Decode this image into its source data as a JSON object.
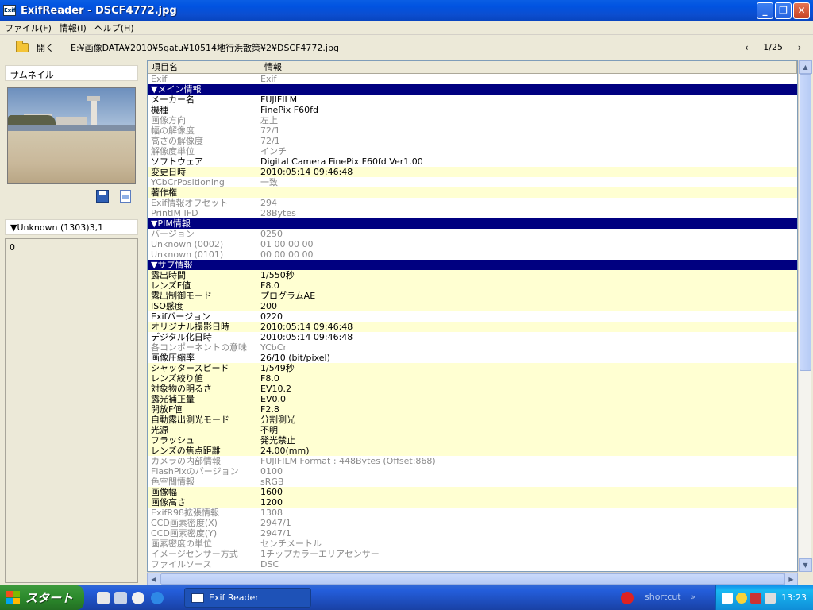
{
  "window": {
    "title": "ExifReader - DSCF4772.jpg",
    "icon_text": "Exif"
  },
  "menu": [
    "ファイル(F)",
    "情報(I)",
    "ヘルプ(H)"
  ],
  "toolbar": {
    "open_label": "開く",
    "path": "E:¥画像DATA¥2010¥5gatu¥10514地行浜散策¥2¥DSCF4772.jpg",
    "prev": "‹",
    "next": "›",
    "page": "1/25"
  },
  "sidebar": {
    "thumb_label": "サムネイル",
    "detail_header": "▼Unknown (1303)3,1",
    "detail_value": "0"
  },
  "table": {
    "col_key": "項目名",
    "col_val": "情報"
  },
  "rows": [
    {
      "t": "dim",
      "k": "Exif",
      "v": "Exif"
    },
    {
      "t": "sec",
      "k": "▼メイン情報",
      "v": ""
    },
    {
      "t": "norm",
      "k": "メーカー名",
      "v": "FUJIFILM"
    },
    {
      "t": "norm",
      "k": "機種",
      "v": "FinePix F60fd"
    },
    {
      "t": "dim",
      "k": "画像方向",
      "v": "左上"
    },
    {
      "t": "dim",
      "k": "幅の解像度",
      "v": "72/1"
    },
    {
      "t": "dim",
      "k": "高さの解像度",
      "v": "72/1"
    },
    {
      "t": "dim",
      "k": "解像度単位",
      "v": "インチ"
    },
    {
      "t": "norm",
      "k": "ソフトウェア",
      "v": "Digital Camera FinePix F60fd   Ver1.00"
    },
    {
      "t": "hl",
      "k": "変更日時",
      "v": "2010:05:14 09:46:48"
    },
    {
      "t": "dim",
      "k": "YCbCrPositioning",
      "v": "一致"
    },
    {
      "t": "hl",
      "k": "著作権",
      "v": ""
    },
    {
      "t": "dim",
      "k": "Exif情報オフセット",
      "v": "294"
    },
    {
      "t": "dim",
      "k": "PrintIM IFD",
      "v": "28Bytes"
    },
    {
      "t": "sec",
      "k": "▼PIM情報",
      "v": ""
    },
    {
      "t": "dim",
      "k": "バージョン",
      "v": "0250"
    },
    {
      "t": "dim",
      "k": "Unknown (0002)",
      "v": "01 00 00 00"
    },
    {
      "t": "dim",
      "k": "Unknown (0101)",
      "v": "00 00 00 00"
    },
    {
      "t": "sec",
      "k": "▼サブ情報",
      "v": ""
    },
    {
      "t": "hl",
      "k": "露出時間",
      "v": "1/550秒"
    },
    {
      "t": "hl",
      "k": "レンズF値",
      "v": "F8.0"
    },
    {
      "t": "hl",
      "k": "露出制御モード",
      "v": "プログラムAE"
    },
    {
      "t": "hl",
      "k": "ISO感度",
      "v": "200"
    },
    {
      "t": "norm",
      "k": "Exifバージョン",
      "v": "0220"
    },
    {
      "t": "hl",
      "k": "オリジナル撮影日時",
      "v": "2010:05:14 09:46:48"
    },
    {
      "t": "norm",
      "k": "デジタル化日時",
      "v": "2010:05:14 09:46:48"
    },
    {
      "t": "dim",
      "k": "各コンポーネントの意味",
      "v": "YCbCr"
    },
    {
      "t": "norm",
      "k": "画像圧縮率",
      "v": "26/10 (bit/pixel)"
    },
    {
      "t": "hl",
      "k": "シャッタースピード",
      "v": "1/549秒"
    },
    {
      "t": "hl",
      "k": "レンズ絞り値",
      "v": "F8.0"
    },
    {
      "t": "hl",
      "k": "対象物の明るさ",
      "v": "EV10.2"
    },
    {
      "t": "hl",
      "k": "露光補正量",
      "v": "EV0.0"
    },
    {
      "t": "hl",
      "k": "開放F値",
      "v": "F2.8"
    },
    {
      "t": "hl",
      "k": "自動露出測光モード",
      "v": "分割測光"
    },
    {
      "t": "hl",
      "k": "光源",
      "v": "不明"
    },
    {
      "t": "hl",
      "k": "フラッシュ",
      "v": "発光禁止"
    },
    {
      "t": "hl",
      "k": "レンズの焦点距離",
      "v": "24.00(mm)"
    },
    {
      "t": "dim",
      "k": "カメラの内部情報",
      "v": "FUJIFILM Format : 448Bytes (Offset:868)"
    },
    {
      "t": "dim",
      "k": "FlashPixのバージョン",
      "v": "0100"
    },
    {
      "t": "dim",
      "k": "色空間情報",
      "v": "sRGB"
    },
    {
      "t": "hl",
      "k": "画像幅",
      "v": "1600"
    },
    {
      "t": "hl",
      "k": "画像高さ",
      "v": "1200"
    },
    {
      "t": "dim",
      "k": "ExifR98拡張情報",
      "v": "1308"
    },
    {
      "t": "dim",
      "k": "CCD画素密度(X)",
      "v": "2947/1"
    },
    {
      "t": "dim",
      "k": "CCD画素密度(Y)",
      "v": "2947/1"
    },
    {
      "t": "dim",
      "k": "画素密度の単位",
      "v": "センチメートル"
    },
    {
      "t": "dim",
      "k": "イメージセンサー方式",
      "v": "1チップカラーエリアセンサー"
    },
    {
      "t": "dim",
      "k": "ファイルソース",
      "v": "DSC"
    }
  ],
  "taskbar": {
    "start_label": "スタート",
    "task_label": "Exif Reader",
    "shortcut": "shortcut",
    "chevron": "»",
    "clock": "13:23"
  }
}
